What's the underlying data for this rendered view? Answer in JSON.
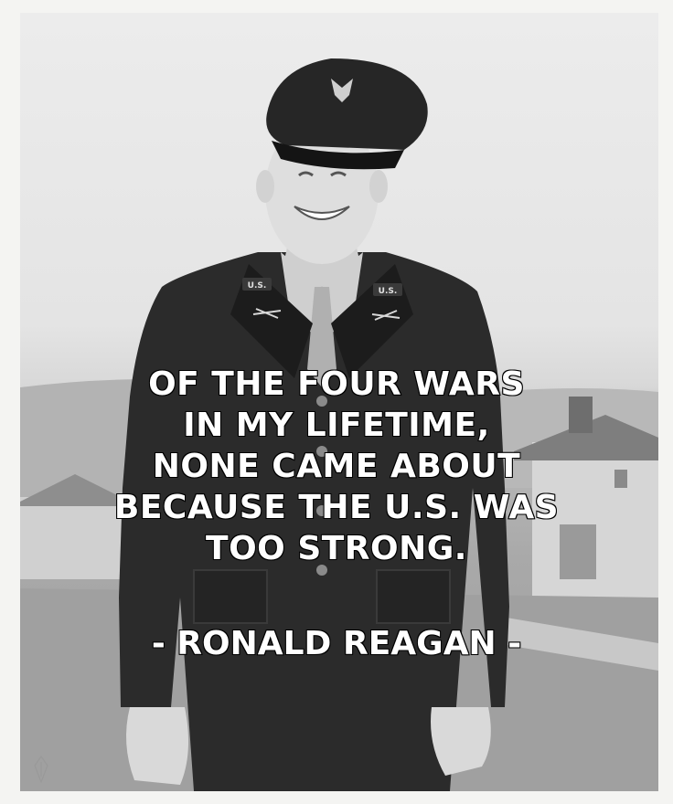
{
  "quote": {
    "lines": [
      "OF THE FOUR WARS",
      "IN MY LIFETIME,",
      "NONE CAME ABOUT",
      "BECAUSE THE U.S. WAS",
      "TOO STRONG."
    ]
  },
  "attribution": "- RONALD REAGAN -",
  "insignia": {
    "collar_left": "U.S.",
    "collar_right": "U.S."
  },
  "colors": {
    "text_fill": "#ffffff",
    "text_stroke": "#000000",
    "uniform": "#2a2a2a",
    "sky": "#e8e8e8"
  }
}
